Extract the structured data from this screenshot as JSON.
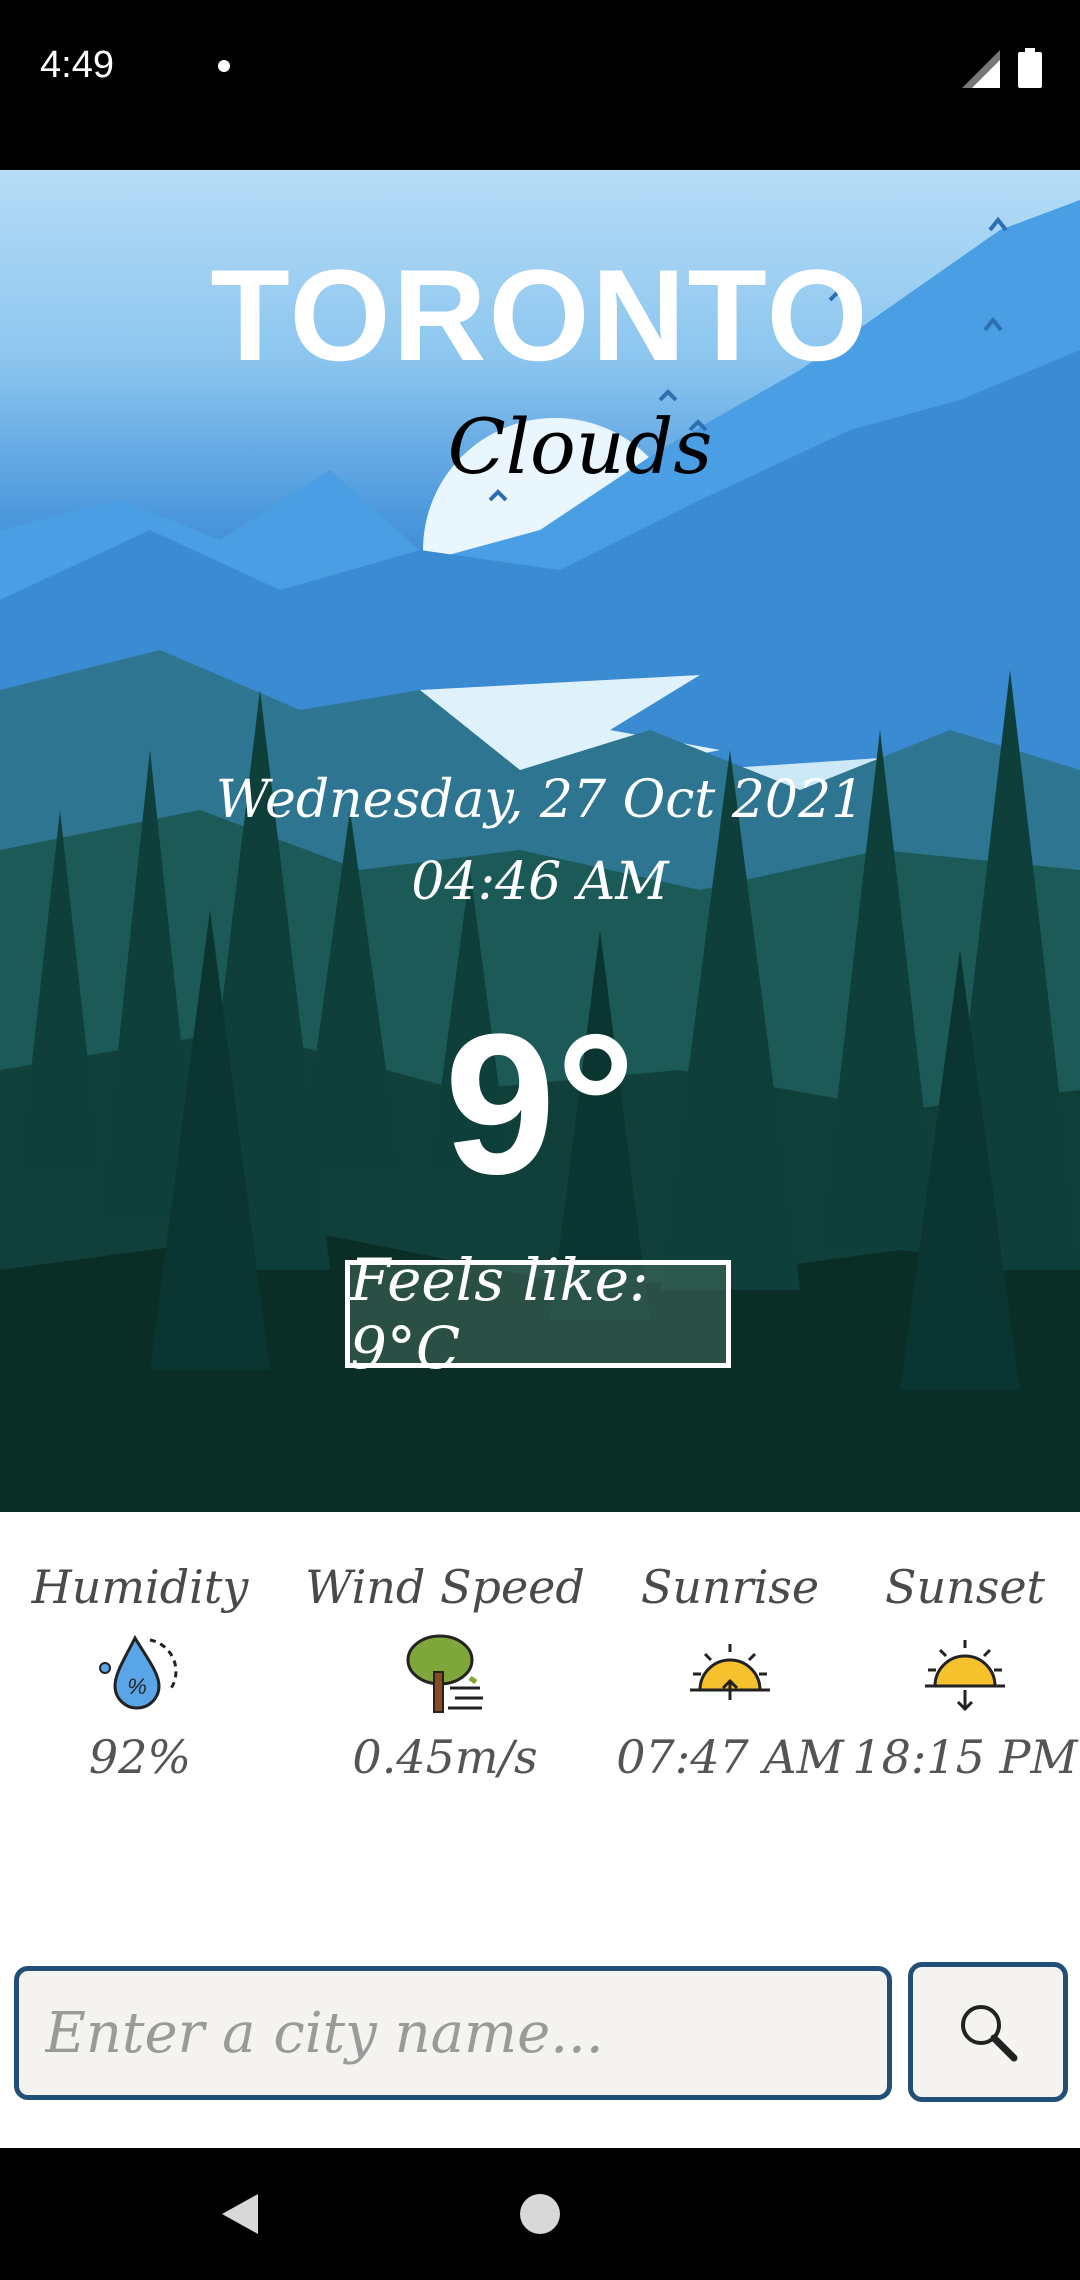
{
  "status_bar": {
    "time": "4:49"
  },
  "weather": {
    "city": "TORONTO",
    "condition": "Clouds",
    "date": "Wednesday, 27 Oct 2021",
    "time": "04:46 AM",
    "temperature": "9°",
    "feels_like": "Feels like: 9°C"
  },
  "stats": [
    {
      "label": "Humidity",
      "value": "92%",
      "icon": "humidity-icon"
    },
    {
      "label": "Wind Speed",
      "value": "0.45m/s",
      "icon": "wind-tree-icon"
    },
    {
      "label": "Sunrise",
      "value": "07:47 AM",
      "icon": "sunrise-icon"
    },
    {
      "label": "Sunset",
      "value": "18:15 PM",
      "icon": "sunset-icon"
    }
  ],
  "search": {
    "placeholder": "Enter a city name..."
  },
  "colors": {
    "accent_border": "#214f78",
    "sun_yellow": "#f5c22e"
  }
}
